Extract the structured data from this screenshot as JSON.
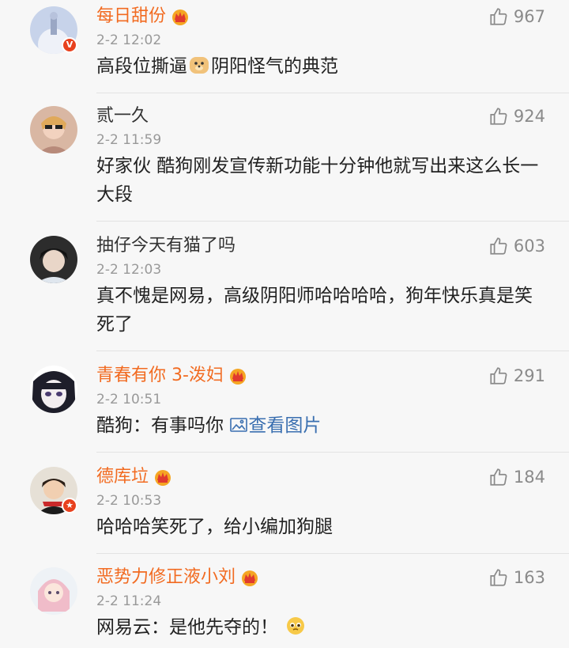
{
  "comments": [
    {
      "username": "每日甜份",
      "time": "2-2 12:02",
      "likes": "967",
      "text_before": "高段位撕逼",
      "text_after": "阴阳怪气的典范"
    },
    {
      "username": "贰一久",
      "time": "2-2 11:59",
      "likes": "924",
      "text": "好家伙 酷狗刚发宣传新功能十分钟他就写出来这么长一大段"
    },
    {
      "username": "抽仔今天有猫了吗",
      "time": "2-2 12:03",
      "likes": "603",
      "text": "真不愧是网易，高级阴阳师哈哈哈哈，狗年快乐真是笑死了"
    },
    {
      "username": "青春有你 3-泼妇",
      "time": "2-2 10:51",
      "likes": "291",
      "text": "酷狗：有事吗你",
      "link": "查看图片"
    },
    {
      "username": "德库垃",
      "time": "2-2 10:53",
      "likes": "184",
      "text": "哈哈哈笑死了，给小编加狗腿"
    },
    {
      "username": "恶势力修正液小刘",
      "time": "2-2 11:24",
      "likes": "163",
      "text": "网易云：是他先夺的！"
    }
  ],
  "icons": {
    "like": "thumbs-up-icon",
    "crown": "vip-crown-icon",
    "verified": "verified-v-icon",
    "image": "image-icon",
    "doge": "doge-emoji",
    "pleading": "pleading-face-emoji"
  },
  "colors": {
    "vip_name": "#f26b21",
    "link": "#3a6fb0",
    "meta": "#999999"
  }
}
